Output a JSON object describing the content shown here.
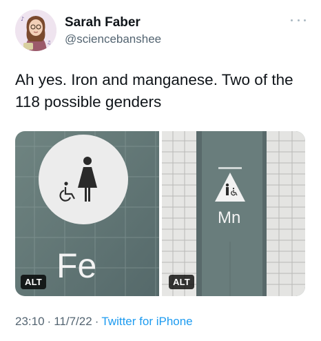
{
  "author": {
    "name": "Sarah Faber",
    "handle": "@sciencebanshee"
  },
  "tweet": {
    "text": "Ah yes. Iron and manganese. Two of the 118 possible genders"
  },
  "media": {
    "left": {
      "sign_text": "Fe",
      "alt_label": "ALT"
    },
    "right": {
      "sign_text": "Mn",
      "alt_label": "ALT"
    }
  },
  "footer": {
    "time": "23:10",
    "separator": "·",
    "date": "11/7/22",
    "source": "Twitter for iPhone"
  },
  "colors": {
    "link": "#1d9bf0",
    "secondary_text": "#536471",
    "wall_teal": "#647a78"
  },
  "icons": [
    "more-icon",
    "woman-icon",
    "wheelchair-icon",
    "man-icon"
  ]
}
